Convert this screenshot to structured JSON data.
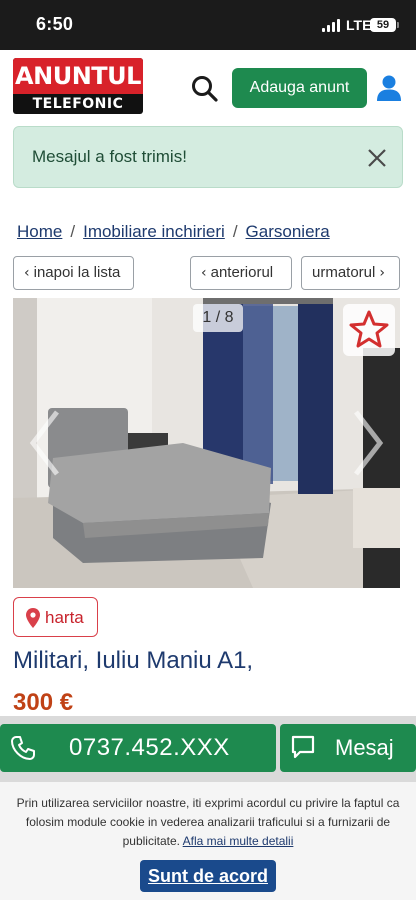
{
  "status_bar": {
    "time": "6:50",
    "network": "LTE",
    "battery": "59"
  },
  "header": {
    "logo_top": "ANUNTUL",
    "logo_bottom": "TELEFONIC",
    "add_button_label": "Adauga anunt",
    "search_icon": "search-icon",
    "user_icon": "user-icon"
  },
  "alert": {
    "message": "Mesajul a fost trimis!",
    "close_icon": "close-icon"
  },
  "breadcrumb": {
    "items": [
      "Home",
      "Imobiliare inchirieri",
      "Garsoniera"
    ],
    "separator": "/"
  },
  "nav": {
    "back_label": "inapoi la lista",
    "prev_label": "anteriorul",
    "next_label": "urmatorul"
  },
  "gallery": {
    "counter": "1 / 8",
    "favorite_icon": "star-icon"
  },
  "listing": {
    "map_label": "harta",
    "title": "Militari, Iuliu Maniu A1,",
    "price": "300 €"
  },
  "contact": {
    "phone": "0737.452.XXX",
    "message_label": "Mesaj",
    "phone_icon": "phone-icon",
    "message_icon": "chat-icon"
  },
  "cookie": {
    "text": "Prin utilizarea serviciilor noastre, iti exprimi acordul cu privire la faptul ca folosim module cookie in vederea analizarii traficului si a furnizarii de publicitate.",
    "link_label": "Afla mai multe detalii",
    "accept_label": "Sunt de acord"
  },
  "colors": {
    "brand_green": "#1e8a4f",
    "brand_red": "#d8222a",
    "link_blue": "#1e3a6e",
    "price_orange": "#c04216",
    "accept_blue": "#1a4a8c"
  }
}
